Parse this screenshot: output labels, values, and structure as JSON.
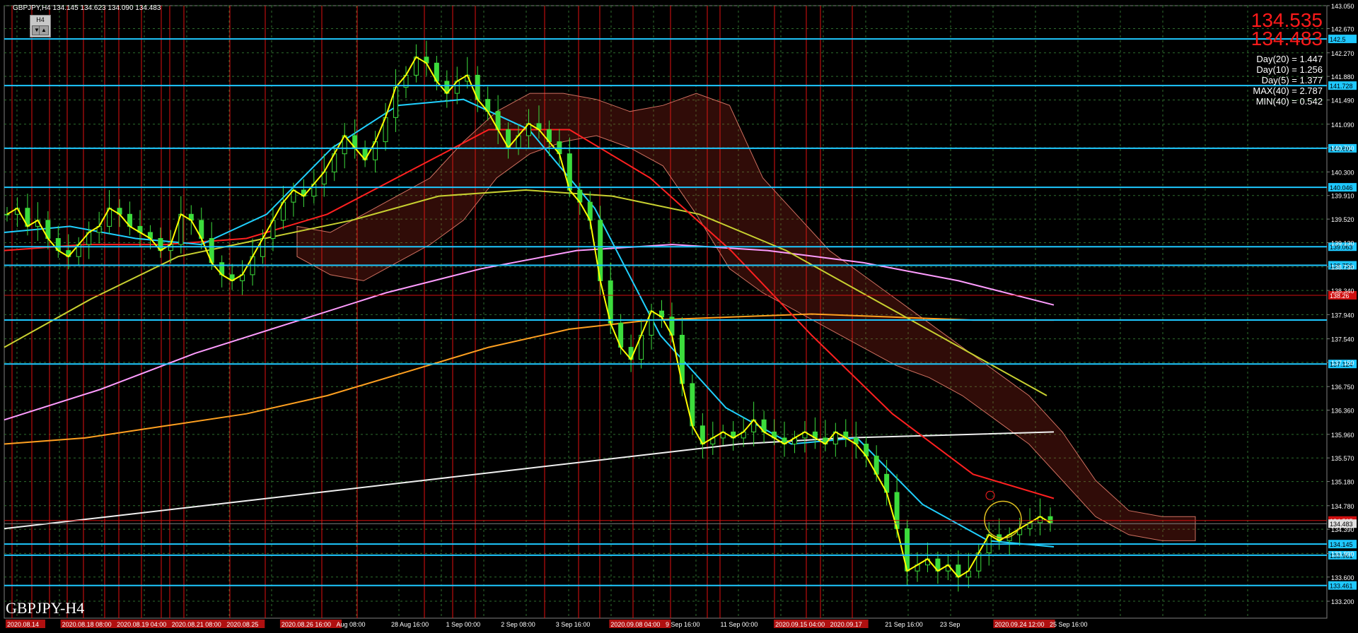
{
  "header": {
    "symbol_line": "GBPJPY,H4  134.145 134.623 134.090 134.483",
    "timeframe_label": "H4"
  },
  "info_panel": {
    "price_1": "134.535",
    "price_2": "134.483",
    "stats": [
      "Day(20) = 1.447",
      "Day(10) = 1.256",
      "Day(5) = 1.377",
      "MAX(40) = 2.787",
      "MIN(40) = 0.542"
    ]
  },
  "watermark": "GBPJPY-H4",
  "colors": {
    "background": "#000000",
    "bull_candle": "#3cdc3c",
    "bear_candle": "#3cdc3c",
    "level_line": "#1ec8ff",
    "red_vertical": "#e01010",
    "sma_fast": "#ffff00",
    "sma_cyan": "#20d0ff",
    "sma_red": "#ff2020",
    "sma_yellowgreen": "#c8d030",
    "sma_pink": "#ff9cff",
    "sma_orange": "#ffa020",
    "sma_white": "#f0f0f0",
    "kumo_bear": "#c03020",
    "kumo_bull": "#3050d0"
  },
  "chart_data": {
    "type": "candlestick",
    "title": "GBPJPY,H4",
    "ylim": [
      132.92,
      143.05
    ],
    "y_ticks": [
      "143.050",
      "142.670",
      "142.270",
      "141.880",
      "141.490",
      "141.090",
      "140.700",
      "140.300",
      "139.910",
      "139.520",
      "139.130",
      "138.730",
      "138.340",
      "137.940",
      "137.540",
      "137.150",
      "136.750",
      "136.360",
      "135.960",
      "135.570",
      "135.180",
      "134.780",
      "134.390",
      "133.990",
      "133.600",
      "133.200"
    ],
    "x_labels": [
      "2020.08.14",
      "2020.08.18 08:00",
      "2020.08.19 04:00",
      "2020.08.21 08:00",
      "2020.08.25",
      "2020.08.26 16:00",
      "Aug 08:00",
      "28 Aug 16:00",
      "1 Sep 00:00",
      "2 Sep 08:00",
      "3 Sep 16:00",
      "2020.09.08 04:00",
      "9 Sep 16:00",
      "11 Sep 00:00",
      "2020.09.15 04:00",
      "2020.09.17",
      "21 Sep 16:00",
      "23 Sep",
      "2020.09.24 12:00",
      "25 Sep 16:00"
    ],
    "horizontal_levels": [
      {
        "price": 142.5,
        "label": "142.5"
      },
      {
        "price": 141.728,
        "label": "141.728"
      },
      {
        "price": 140.691,
        "label": "140.691"
      },
      {
        "price": 140.046,
        "label": "140.046"
      },
      {
        "price": 139.063,
        "label": "139.063"
      },
      {
        "price": 138.756,
        "label": "138.756"
      },
      {
        "price": 137.85,
        "label": ""
      },
      {
        "price": 137.124,
        "label": "137.124"
      },
      {
        "price": 134.145,
        "label": "134.145"
      },
      {
        "price": 133.961,
        "label": "133.961"
      },
      {
        "price": 133.461,
        "label": "133.461"
      }
    ],
    "price_markers": [
      {
        "price": 138.26,
        "label": "138.26",
        "color": "#d01010"
      },
      {
        "price": 134.535,
        "label": "134.535",
        "color": "#d01010"
      },
      {
        "price": 134.483,
        "label": "134.483",
        "color": "#202020"
      }
    ],
    "close_path": [
      139.6,
      139.7,
      139.4,
      139.5,
      139.2,
      139.0,
      138.9,
      139.1,
      139.3,
      139.4,
      139.7,
      139.6,
      139.4,
      139.3,
      139.2,
      139.0,
      139.1,
      139.6,
      139.5,
      139.2,
      138.8,
      138.6,
      138.5,
      138.6,
      138.9,
      139.2,
      139.5,
      139.8,
      140.0,
      139.9,
      140.1,
      140.3,
      140.6,
      140.9,
      140.7,
      140.5,
      140.8,
      141.2,
      141.7,
      141.9,
      142.2,
      142.1,
      141.8,
      141.6,
      141.8,
      141.9,
      141.5,
      141.3,
      141.0,
      140.7,
      140.9,
      141.1,
      141.0,
      140.8,
      140.6,
      140.0,
      139.8,
      139.5,
      138.5,
      137.8,
      137.4,
      137.2,
      137.6,
      138.0,
      137.9,
      137.6,
      136.8,
      136.1,
      135.8,
      135.9,
      136.0,
      135.9,
      136.0,
      136.2,
      136.0,
      135.9,
      135.8,
      135.9,
      136.0,
      135.9,
      135.8,
      136.0,
      135.9,
      135.8,
      135.6,
      135.3,
      135.0,
      134.4,
      133.7,
      133.8,
      133.9,
      133.7,
      133.8,
      133.6,
      133.7,
      134.0,
      134.3,
      134.2,
      134.3,
      134.4,
      134.5,
      134.6,
      134.5
    ]
  }
}
